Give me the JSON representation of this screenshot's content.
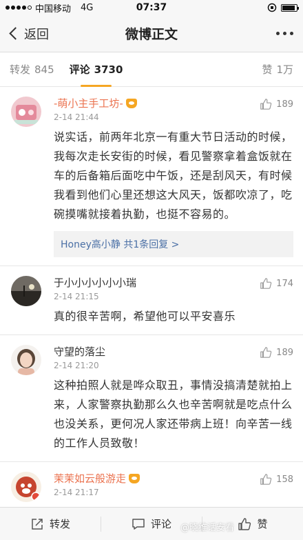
{
  "status_bar": {
    "carrier": "中国移动",
    "network": "4G",
    "time": "07:37"
  },
  "nav": {
    "back_label": "返回",
    "title": "微博正文"
  },
  "tabs": [
    {
      "label": "转发",
      "count": "845"
    },
    {
      "label": "评论",
      "count": "3730"
    },
    {
      "label": "赞",
      "count": "1万"
    }
  ],
  "comments": [
    {
      "user": "-萌小主手工坊-",
      "time": "2-14 21:44",
      "likes": "189",
      "text": "说实话，前两年北京一有重大节日活动的时候，我每次走长安街的时候，看见警察拿着盒饭就在车的后备箱后面吃中午饭，还是刮风天，有时候我看到他们心里还想这大风天，饭都吹凉了，吃碗摸嘴就接着执勤，也挺不容易的。",
      "replies": "Honey高小静 共1条回复 >"
    },
    {
      "user": "于小小小小小小瑞",
      "time": "2-14 21:15",
      "likes": "174",
      "text": "真的很辛苦啊，希望他可以平安喜乐"
    },
    {
      "user": "守望的落尘",
      "time": "2-14 21:20",
      "likes": "189",
      "text": "这种拍照人就是哗众取丑，事情没搞清楚就拍上来，人家警察执勤那么久也辛苦啊就是吃点什么也没关系，更何况人家还带病上班！向辛苦一线的工作人员致敬！"
    },
    {
      "user": "茉茉如云般游走",
      "time": "2-14 21:17",
      "likes": "158"
    }
  ],
  "bottom_bar": {
    "repost": "转发",
    "comment": "评论",
    "like": "赞"
  },
  "watermark": "@晓维话安看",
  "colors": {
    "accent": "#f5a623",
    "vip_name": "#eb7350",
    "link": "#4a6fa5"
  }
}
